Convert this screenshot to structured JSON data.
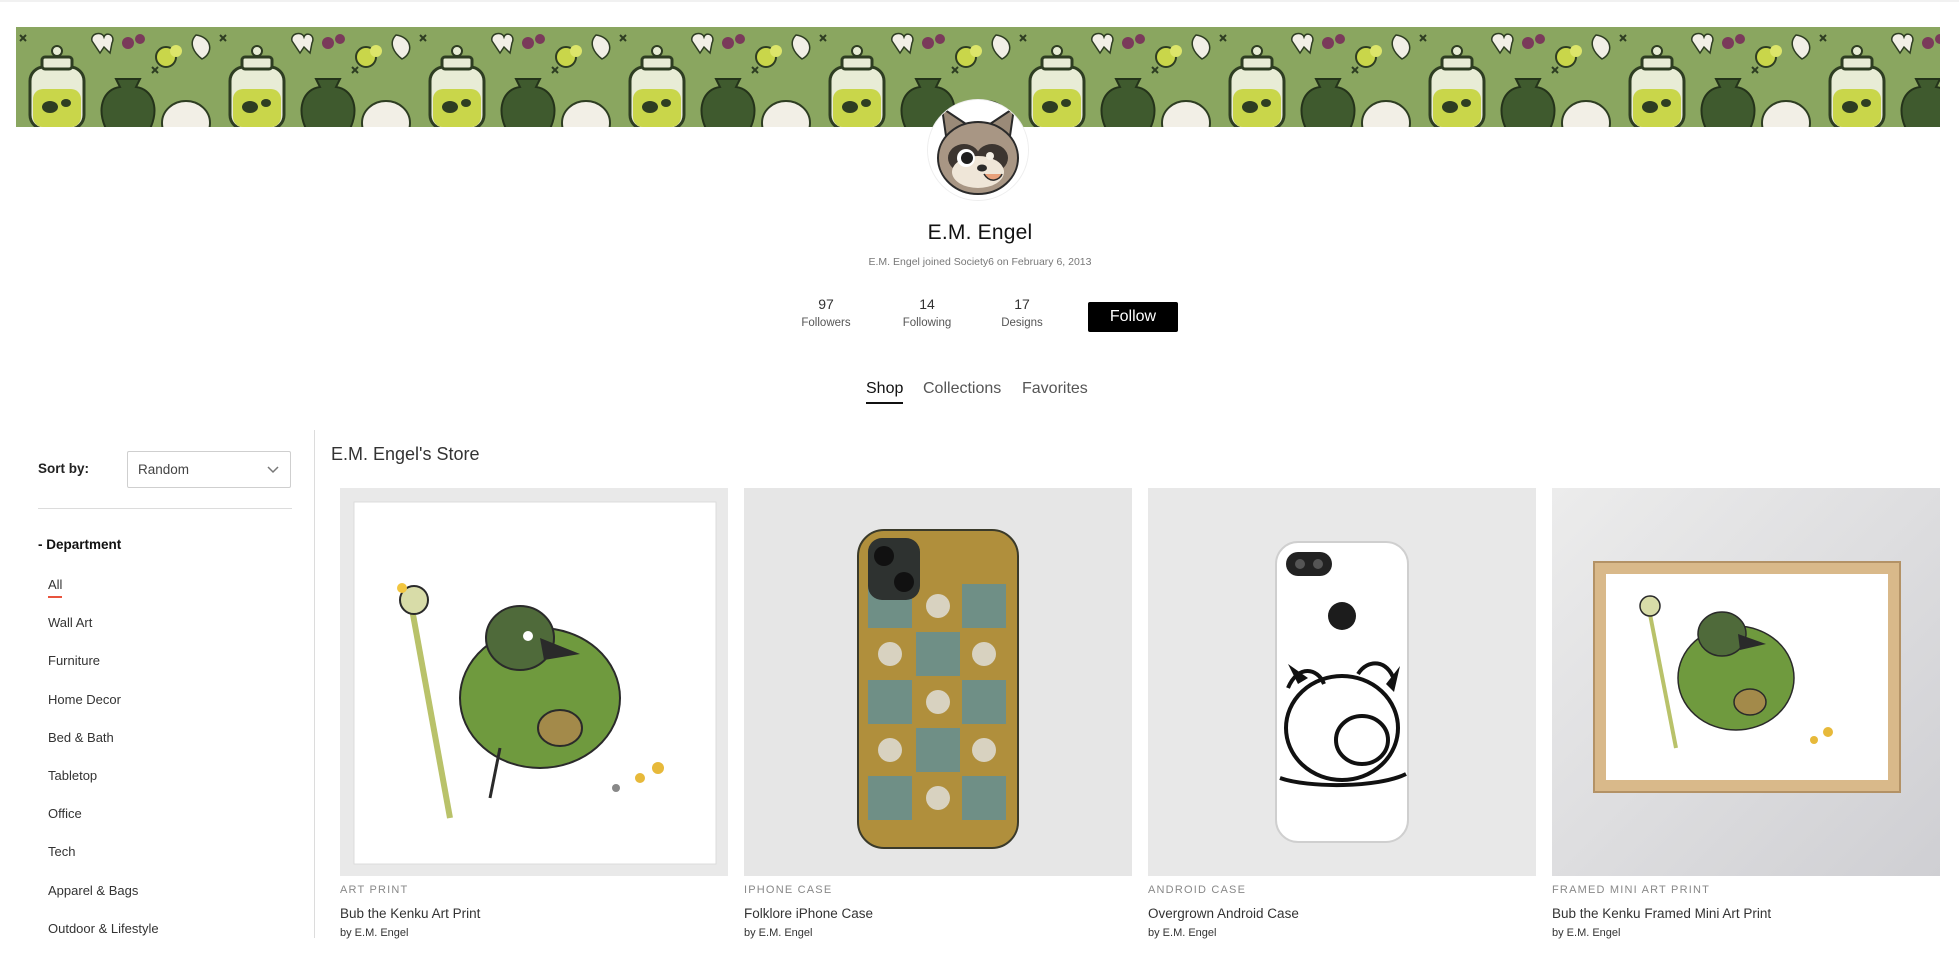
{
  "profile": {
    "name": "E.M. Engel",
    "joined": "E.M. Engel joined Society6 on February 6, 2013",
    "follow_label": "Follow"
  },
  "stats": [
    {
      "value": "97",
      "label": "Followers"
    },
    {
      "value": "14",
      "label": "Following"
    },
    {
      "value": "17",
      "label": "Designs"
    }
  ],
  "tabs": [
    {
      "label": "Shop",
      "active": true
    },
    {
      "label": "Collections",
      "active": false
    },
    {
      "label": "Favorites",
      "active": false
    }
  ],
  "sidebar": {
    "sort_label": "Sort by:",
    "sort_value": "Random",
    "department_heading": "- Department",
    "departments": [
      "All",
      "Wall Art",
      "Furniture",
      "Home Decor",
      "Bed & Bath",
      "Tabletop",
      "Office",
      "Tech",
      "Apparel & Bags",
      "Outdoor & Lifestyle"
    ]
  },
  "store": {
    "title": "E.M. Engel's Store",
    "products": [
      {
        "type": "ART PRINT",
        "title": "Bub the Kenku Art Print",
        "by": "by E.M. Engel"
      },
      {
        "type": "IPHONE CASE",
        "title": "Folklore iPhone Case",
        "by": "by E.M. Engel"
      },
      {
        "type": "ANDROID CASE",
        "title": "Overgrown Android Case",
        "by": "by E.M. Engel"
      },
      {
        "type": "FRAMED MINI ART PRINT",
        "title": "Bub the Kenku Framed Mini Art Print",
        "by": "by E.M. Engel"
      }
    ]
  },
  "icons": {
    "sort_chevron": "chevron-down-icon"
  },
  "colors": {
    "banner_green": "#8aa660",
    "follow_button": "#000000",
    "active_underline": "#e8543e"
  }
}
